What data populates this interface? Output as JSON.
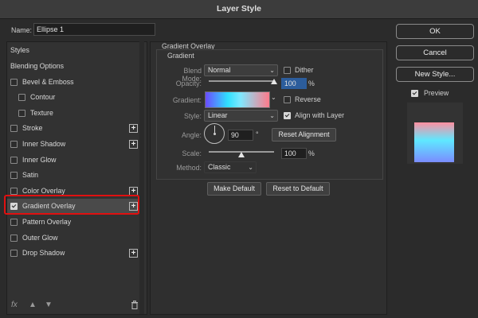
{
  "window": {
    "title": "Layer Style"
  },
  "name_field": {
    "label": "Name:",
    "value": "Ellipse 1"
  },
  "styles_panel": {
    "header": "Styles",
    "items": [
      {
        "label": "Blending Options",
        "checkbox": false,
        "checked": false,
        "plus": false,
        "indent": false
      },
      {
        "label": "Bevel & Emboss",
        "checkbox": true,
        "checked": false,
        "plus": false,
        "indent": false
      },
      {
        "label": "Contour",
        "checkbox": true,
        "checked": false,
        "plus": false,
        "indent": true
      },
      {
        "label": "Texture",
        "checkbox": true,
        "checked": false,
        "plus": false,
        "indent": true
      },
      {
        "label": "Stroke",
        "checkbox": true,
        "checked": false,
        "plus": true,
        "indent": false
      },
      {
        "label": "Inner Shadow",
        "checkbox": true,
        "checked": false,
        "plus": true,
        "indent": false
      },
      {
        "label": "Inner Glow",
        "checkbox": true,
        "checked": false,
        "plus": false,
        "indent": false
      },
      {
        "label": "Satin",
        "checkbox": true,
        "checked": false,
        "plus": false,
        "indent": false
      },
      {
        "label": "Color Overlay",
        "checkbox": true,
        "checked": false,
        "plus": true,
        "indent": false
      },
      {
        "label": "Gradient Overlay",
        "checkbox": true,
        "checked": true,
        "plus": true,
        "indent": false,
        "selected": true
      },
      {
        "label": "Pattern Overlay",
        "checkbox": true,
        "checked": false,
        "plus": false,
        "indent": false
      },
      {
        "label": "Outer Glow",
        "checkbox": true,
        "checked": false,
        "plus": false,
        "indent": false
      },
      {
        "label": "Drop Shadow",
        "checkbox": true,
        "checked": false,
        "plus": true,
        "indent": false
      }
    ],
    "fx_label": "fx",
    "plus_glyph": "+"
  },
  "gradient_overlay": {
    "section_title": "Gradient Overlay",
    "group_title": "Gradient",
    "blend_mode": {
      "label": "Blend Mode:",
      "value": "Normal"
    },
    "dither": {
      "label": "Dither",
      "checked": false
    },
    "opacity": {
      "label": "Opacity:",
      "value": "100",
      "unit": "%",
      "level": 1.0
    },
    "gradient": {
      "label": "Gradient:"
    },
    "reverse": {
      "label": "Reverse",
      "checked": false
    },
    "style": {
      "label": "Style:",
      "value": "Linear"
    },
    "align_with_layer": {
      "label": "Align with Layer",
      "checked": true
    },
    "angle": {
      "label": "Angle:",
      "value": "90",
      "unit": "°"
    },
    "reset_alignment": "Reset Alignment",
    "scale": {
      "label": "Scale:",
      "value": "100",
      "unit": "%",
      "level": 0.5
    },
    "method": {
      "label": "Method:",
      "value": "Classic"
    },
    "make_default": "Make Default",
    "reset_to_default": "Reset to Default"
  },
  "right_panel": {
    "ok": "OK",
    "cancel": "Cancel",
    "new_style": "New Style...",
    "preview": {
      "label": "Preview",
      "checked": true
    }
  },
  "colors": {
    "gradient_stops": [
      "#6a4cff",
      "#2fe0ff",
      "#7fe8ff",
      "#ff7a8a"
    ],
    "highlight": "#e01010"
  }
}
